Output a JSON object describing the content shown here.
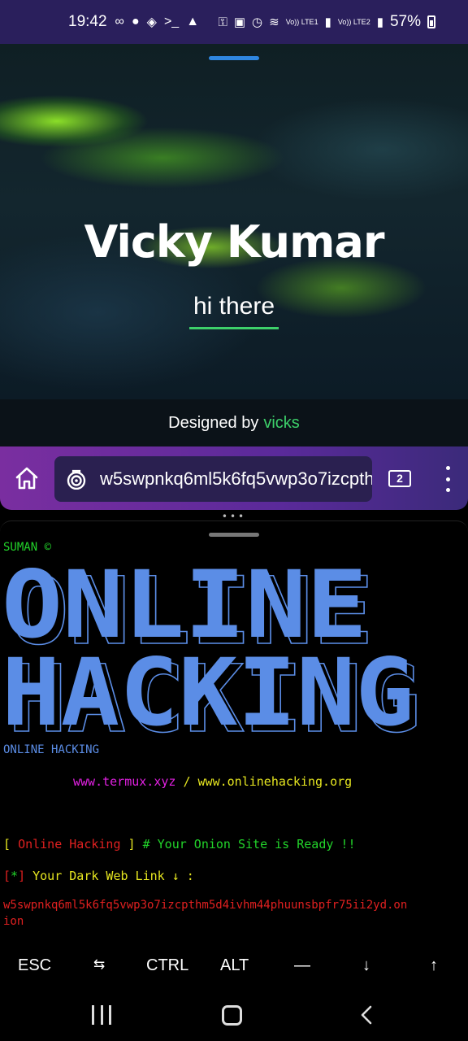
{
  "status_bar": {
    "time": "19:42",
    "left_icons": [
      "infinity-icon",
      "fire-icon",
      "shield-icon",
      "terminal-icon",
      "bell-icon"
    ],
    "right_icons": [
      "key-icon",
      "lock-icon",
      "alarm-icon",
      "wifi-icon"
    ],
    "sim1_label": "Vo)) LTE1",
    "sim2_label": "Vo)) LTE2",
    "battery": "57%"
  },
  "hero": {
    "name": "Vicky Kumar",
    "subtitle": "hi there"
  },
  "credit": {
    "prefix": "Designed by",
    "author": "vicks"
  },
  "browser": {
    "url": "w5swpnkq6ml5k6fq5vwp3o7izcpthm5d4ivhm44phuunsbpfr75ii2yd.onion",
    "tab_count": "2"
  },
  "terminal": {
    "credit": "SUMAN ©",
    "banner_line1": "ONLINE",
    "banner_line2": "HACKING",
    "banner_caption": "ONLINE HACKING",
    "site1": "www.termux.xyz",
    "separator": "/",
    "site2": "www.onlinehacking.org",
    "ready_open": "[",
    "ready_name": "Online Hacking",
    "ready_close": "]",
    "ready_msg": "# Your Onion Site is Ready !!",
    "link_open": "[",
    "link_star": "*",
    "link_close": "]",
    "link_msg": "Your Dark Web Link ↓ :",
    "onion_line1": "w5swpnkq6ml5k6fq5vwp3o7izcpthm5d4ivhm44phuunsbpfr75ii2yd.on",
    "onion_line2": "ion"
  },
  "extra_keys": {
    "esc": "ESC",
    "tab": "⇆",
    "ctrl": "CTRL",
    "alt": "ALT",
    "dash": "—",
    "down": "↓",
    "up": "↑"
  },
  "colors": {
    "terminal_green": "#22d32a",
    "terminal_red": "#e02020",
    "terminal_yellow": "#e6e620",
    "terminal_magenta": "#e020e0",
    "banner_blue": "#5b8de6",
    "accent_green": "#3dd06a"
  }
}
